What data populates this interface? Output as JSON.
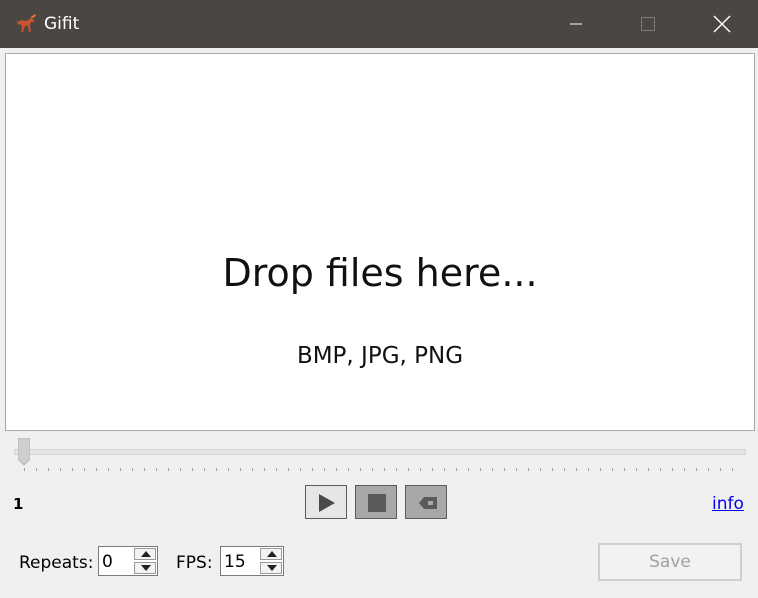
{
  "window": {
    "title": "Gifit",
    "icon": "gifit-app-icon",
    "controls": [
      "minimize-icon",
      "maximize-icon",
      "close-icon"
    ]
  },
  "drop_zone": {
    "title": "Drop files here...",
    "formats": "BMP, JPG, PNG"
  },
  "timeline": {
    "position": 0,
    "frame_number": "1"
  },
  "playback": {
    "icons": [
      "play-icon",
      "stop-icon",
      "rewind-icon"
    ]
  },
  "info_link": "info",
  "settings": {
    "repeats_label": "Repeats:",
    "repeats_value": "0",
    "fps_label": "FPS:",
    "fps_value": "15"
  },
  "save_label": "Save",
  "colors": {
    "titlebar": "#494643",
    "link": "#0000ee",
    "disabled_text": "#a0a0a0"
  }
}
